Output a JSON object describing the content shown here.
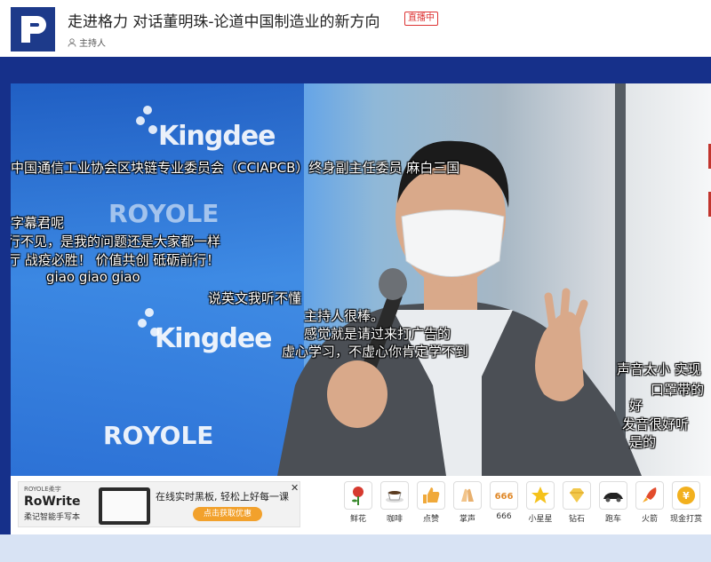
{
  "header": {
    "title": "走进格力 对话董明珠-论道中国制造业的新方向",
    "live_badge": "直播中",
    "host_label": "主持人"
  },
  "video": {
    "brand_kingdee": "Kingdee",
    "brand_royole": "ROYOLE"
  },
  "danmaku": [
    "中国通信工业协会区块链专业委员会（CCIAPCB）终身副主任委员 麻白三国",
    "字幕君呢",
    "行不见，是我的问题还是大家都一样",
    "厅 战疫必胜！ 价值共创 砥砺前行！",
    "giao giao giao",
    "说英文我听不懂",
    "主持人很棒。",
    "感觉就是请过来打广告的",
    "虚心学习，不虚心你肯定学不到",
    "声音太小 实现",
    "口罩带的",
    "好",
    "发音很好听",
    "是的"
  ],
  "ad": {
    "logo_small": "ROYOLE柔宇",
    "brand": "RoWrite",
    "subtitle": "柔记智能手写本",
    "headline": "在线实时黑板, 轻松上好每一课",
    "button": "点击获取优惠"
  },
  "gifts": [
    {
      "label": "鲜花"
    },
    {
      "label": "咖啡"
    },
    {
      "label": "点赞"
    },
    {
      "label": "掌声"
    },
    {
      "label": "666",
      "icon_text": "666"
    },
    {
      "label": "小星星"
    },
    {
      "label": "钻石"
    },
    {
      "label": "跑车"
    },
    {
      "label": "火箭"
    },
    {
      "label": "现金打赏",
      "icon_text": "¥"
    }
  ]
}
